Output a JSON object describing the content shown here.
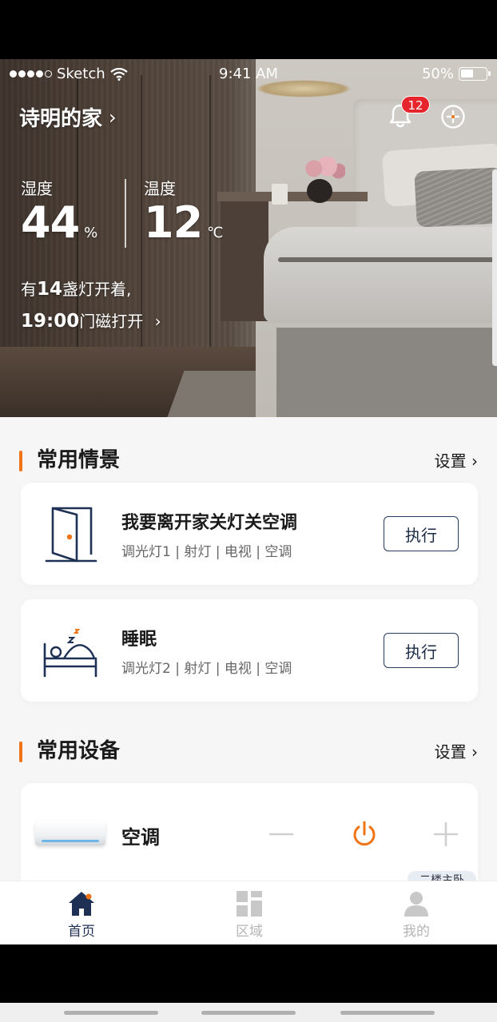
{
  "status_bar": {
    "carrier": "Sketch",
    "time": "9:41 AM",
    "battery_percent": "50%",
    "battery_level": 0.5
  },
  "header": {
    "home_name": "诗明的家",
    "chevron": "›",
    "notification_count": "12"
  },
  "climate": {
    "humidity_label": "湿度",
    "humidity_value": "44",
    "humidity_unit": "%",
    "temperature_label": "温度",
    "temperature_value": "12",
    "temperature_unit": "℃"
  },
  "summary": {
    "line1_prefix": "有",
    "lights_count": "14",
    "line1_suffix": "盏灯开着,",
    "door_time": "19:00",
    "line2_suffix": "门磁打开",
    "chevron": "›"
  },
  "scenes_section": {
    "title": "常用情景",
    "setting_label": "设置 ›",
    "items": [
      {
        "name": "我要离开家关灯关空调",
        "devices": "调光灯1 | 射灯 | 电视 | 空调",
        "action": "执行",
        "icon": "door-icon"
      },
      {
        "name": "睡眠",
        "devices": "调光灯2 | 射灯 | 电视 | 空调",
        "action": "执行",
        "icon": "sleep-bed-icon"
      }
    ]
  },
  "devices_section": {
    "title": "常用设备",
    "setting_label": "设置 ›",
    "items": [
      {
        "name": "空调",
        "room": "二楼主卧",
        "icon": "air-conditioner-icon"
      }
    ]
  },
  "tabbar": {
    "items": [
      {
        "label": "首页",
        "icon": "home-icon",
        "active": true
      },
      {
        "label": "区域",
        "icon": "grid-icon",
        "active": false
      },
      {
        "label": "我的",
        "icon": "user-icon",
        "active": false
      }
    ]
  },
  "colors": {
    "accent": "#f07316",
    "navy": "#1e3154",
    "badge_red": "#e5242b"
  }
}
